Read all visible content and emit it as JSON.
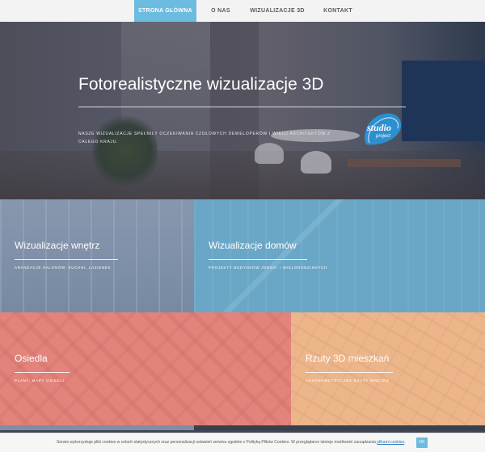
{
  "nav": {
    "items": [
      {
        "label": "STRONA GŁÓWNA",
        "active": true
      },
      {
        "label": "O NAS",
        "active": false
      },
      {
        "label": "WIZUALIZACJE 3D",
        "active": false
      },
      {
        "label": "KONTAKT",
        "active": false
      }
    ]
  },
  "hero": {
    "title": "Fotorealistyczne wizualizacje 3D",
    "description": "NASZE WIZUALIZACJE SPEŁNIŁY OCZEKIWANIA CZOŁOWYCH DEWELOPERÓW I WIELU ARCHITEKTÓW Z CAŁEGO KRAJU.",
    "logo": {
      "line1": "studio",
      "line2": "project"
    }
  },
  "tiles": [
    {
      "title": "Wizualizacje wnętrz",
      "subtitle": "ARANŻACJE SALONÓW, KUCHNI, ŁAZIENEK",
      "color": "#7d8fa8"
    },
    {
      "title": "Wizualizacje domów",
      "subtitle": "PROJEKTY BUDYNKÓW JEDNO- I WIELORODZINNYCH",
      "color": "#6aa7c6"
    },
    {
      "title": "Osiedla",
      "subtitle": "PLANY, MAPY OSIEDLI",
      "color": "#e3837b"
    },
    {
      "title": "Rzuty 3D mieszkań",
      "subtitle": "AKSONOMETRYCZNE RZUTY WNĘTRZ",
      "color": "#ecb58a"
    }
  ],
  "cookie": {
    "text": "Serwis wykorzystuje pliki cookies w celach statystycznych oraz personalizacji ustawień serwisu zgodnie z Polityką Plików Cookies. W przeglądarce istnieje możliwość zarządzania",
    "link": "plikami cookies",
    "ok": "OK"
  },
  "colors": {
    "accent": "#6cbbe0",
    "nav_bg": "#f3f3f3"
  }
}
